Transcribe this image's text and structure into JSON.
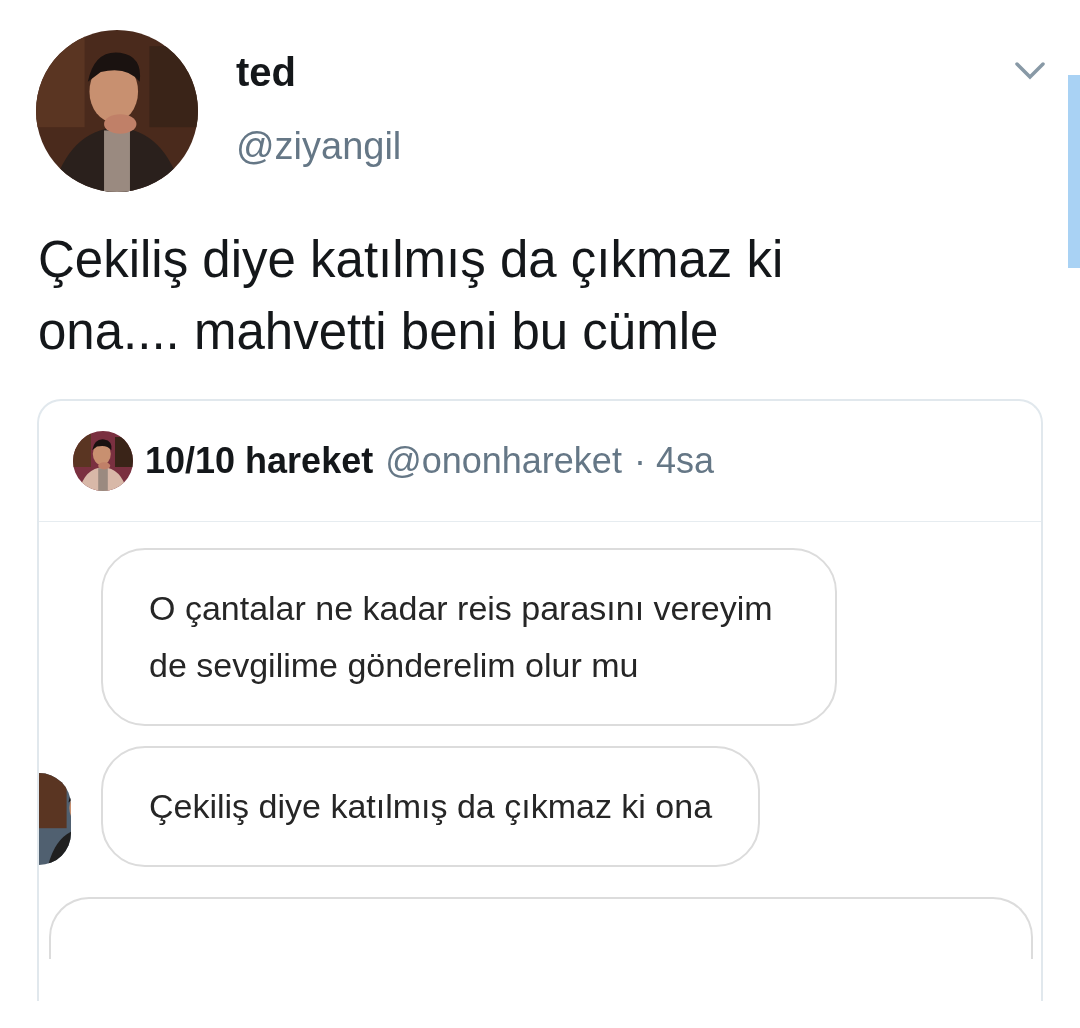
{
  "tweet": {
    "author": {
      "name": "ted",
      "handle": "@ziyangil"
    },
    "text": "Çekiliş diye katılmış da çıkmaz ki ona.... mahvetti beni bu cümle",
    "quoted": {
      "name": "10/10 hareket",
      "handle": "@ononhareket",
      "time": "· 4sa",
      "messages": [
        {
          "text": "O çantalar ne kadar reis parasını vereyim de sevgilime gönderelim olur mu",
          "avatar": false
        },
        {
          "text": "Çekiliş diye katılmış da çıkmaz ki ona",
          "avatar": true
        }
      ]
    }
  }
}
